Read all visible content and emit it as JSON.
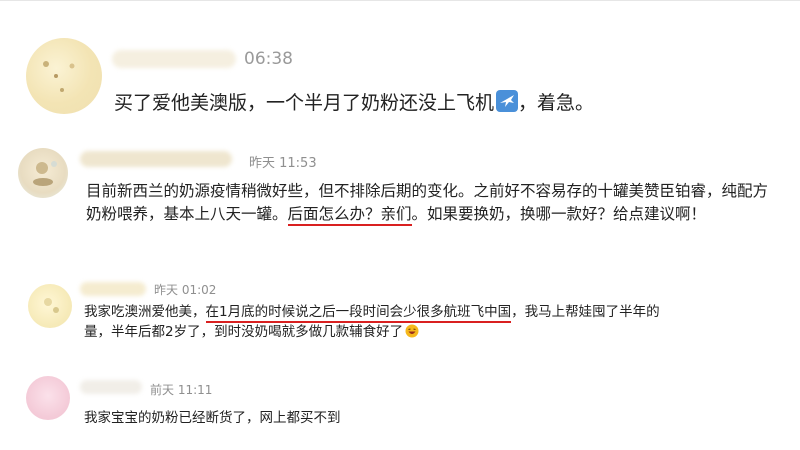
{
  "comments": [
    {
      "time": "06:38",
      "text_before": "买了爱他美澳版，一个半月了奶粉还没上飞机",
      "text_after": "，着急。",
      "icon": "airplane-emoji"
    },
    {
      "time": "昨天 11:53",
      "text_before": "目前新西兰的奶源疫情稍微好些，但不排除后期的变化。之前好不容易存的十罐美赞臣铂睿，纯配方奶粉喂养，基本上八天一罐。",
      "text_highlight": "后面怎么办？亲们",
      "text_after": "。如果要换奶，换哪一款好？给点建议啊！"
    },
    {
      "time": "昨天 01:02",
      "text_before": "我家吃澳洲爱他美，",
      "text_highlight": "在1月底的时候说之后一段时间会少很多航班飞中国",
      "text_after": "，我马上帮娃囤了半年的量，半年后都2岁了，到时没奶喝就多做几款辅食好了",
      "icon": "laughing-emoji"
    },
    {
      "time": "前天 11:11",
      "text": "我家宝宝的奶粉已经断货了，网上都买不到"
    }
  ]
}
